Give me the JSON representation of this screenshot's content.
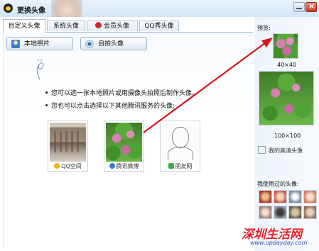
{
  "window": {
    "title": "更换头像"
  },
  "tabs": [
    {
      "label": "自定义头像",
      "active": true
    },
    {
      "label": "系统头像",
      "active": false
    },
    {
      "label": "会员头像",
      "active": false,
      "icon": "member-icon"
    },
    {
      "label": "QQ秀头像",
      "active": false
    }
  ],
  "toolbar": {
    "local_photo_label": "本地照片",
    "camera_label": "自拍头像"
  },
  "instructions": [
    "您可以选一张本地照片或用摄像头拍照后制作头像。",
    "您也可以点击选择以下其他腾讯服务的头像:"
  ],
  "services": [
    {
      "label": "QQ空间",
      "icon": "qzone-star-icon"
    },
    {
      "label": "腾讯微博",
      "icon": "weibo-icon"
    },
    {
      "label": "朋友网",
      "icon": "pengyou-icon"
    }
  ],
  "preview": {
    "label": "预览:",
    "small_size": "40×40",
    "large_size": "100×100"
  },
  "hd_avatar_label": "我的高清头像",
  "used_avatars_label": "我使用过的头像:",
  "watermark": {
    "text": "深圳生活网",
    "url": "www.updayday.com"
  },
  "colors": {
    "arrow": "#d7151b",
    "accent": "#3a7fcf"
  }
}
